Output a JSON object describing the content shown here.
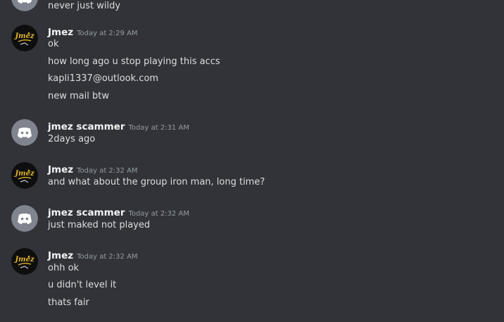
{
  "messages": [
    {
      "author": "",
      "avatar": "discord-default",
      "timestamp": "",
      "lines": [
        "never just wildy"
      ]
    },
    {
      "author": "Jmez",
      "avatar": "jmez-logo",
      "timestamp": "Today at 2:29 AM",
      "lines": [
        "ok",
        "how long ago u stop playing this accs",
        "kapli1337@outlook.com",
        "new mail btw"
      ]
    },
    {
      "author": "jmez scammer",
      "avatar": "discord-default",
      "timestamp": "Today at 2:31 AM",
      "lines": [
        "2days ago"
      ]
    },
    {
      "author": "Jmez",
      "avatar": "jmez-logo",
      "timestamp": "Today at 2:32 AM",
      "lines": [
        "and what about the group iron man, long time?"
      ]
    },
    {
      "author": "jmez scammer",
      "avatar": "discord-default",
      "timestamp": "Today at 2:32 AM",
      "lines": [
        "just maked not played"
      ]
    },
    {
      "author": "Jmez",
      "avatar": "jmez-logo",
      "timestamp": "Today at 2:32 AM",
      "lines": [
        "ohh ok",
        "u didn't level it",
        "thats fair"
      ]
    }
  ],
  "colors": {
    "background": "#313338",
    "default_avatar": "#80848e",
    "jmez_avatar_bg": "#0e0e0e",
    "jmez_avatar_gold": "#e0b52a"
  }
}
